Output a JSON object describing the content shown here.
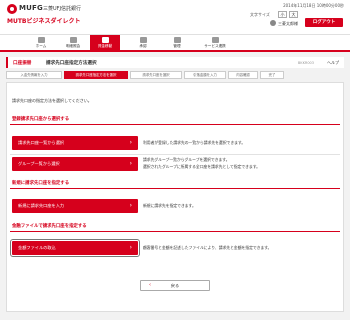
{
  "header": {
    "brand": "MUFG",
    "bank_name": "三菱UFJ信託銀行",
    "service_name": "MUTBビジネスダイレクト",
    "datetime": "2014年11月18日 10時00分00秒",
    "font_size_label": "文字サイズ",
    "font_small": "小",
    "font_large": "大",
    "user_name": "三菱太郎様",
    "logout_label": "ログアウト"
  },
  "nav": {
    "items": [
      {
        "label": "ホーム"
      },
      {
        "label": "明細照会"
      },
      {
        "label": "資金移動"
      },
      {
        "label": "承認"
      },
      {
        "label": "管理"
      },
      {
        "label": "サービス連携"
      }
    ]
  },
  "title": {
    "main": "口座振替",
    "sub": "請求先口座指定方法選択",
    "screen_id": "BKKR003",
    "help": "ヘルプ"
  },
  "steps": [
    {
      "label": "入金先情報を入力"
    },
    {
      "label": "請求先口座指定方法を選択"
    },
    {
      "label": "請求先口座を選択"
    },
    {
      "label": "引落金額を入力"
    },
    {
      "label": "内容確認"
    },
    {
      "label": "完了"
    }
  ],
  "instruction": "請求先口座の指定方法を選択してください。",
  "sections": {
    "registered": {
      "heading": "登録請求先口座から選択する",
      "btn_list": "請求先口座一覧から選択",
      "desc_list": "利用者が登録した請求先の一覧から請求先を選択できます。",
      "btn_group": "グループ一覧から選択",
      "desc_group_1": "請求先グループ一覧からグループを選択できます。",
      "desc_group_2": "選択されたグループに所属する全口座を請求先として指定できます。"
    },
    "new": {
      "heading": "新規に請求先口座を指定する",
      "btn": "新規に請求先口座を入力",
      "desc": "新規に請求先を指定できます。"
    },
    "file": {
      "heading": "金融ファイルで請求先口座を指定する",
      "btn": "金額ファイルの取込",
      "desc": "顧客番号と金額を記述したファイルにより、請求先と金額を指定できます。"
    }
  },
  "back_label": "戻る"
}
